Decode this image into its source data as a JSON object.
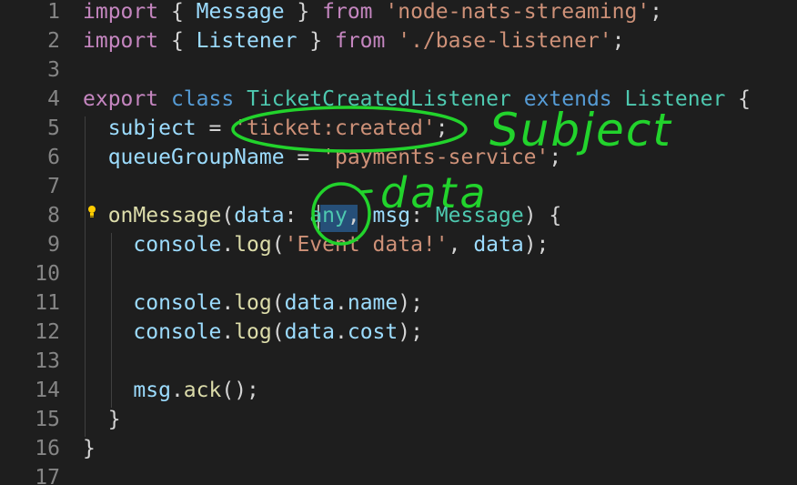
{
  "colors": {
    "background": "#1e1e1e",
    "line_number": "#858585",
    "keyword": "#c586c0",
    "storage": "#569cd6",
    "type": "#4ec9b0",
    "string": "#ce9178",
    "property": "#9cdcfe",
    "function": "#dcdcaa",
    "punctuation": "#d4d4d4",
    "annotation": "#22d32c"
  },
  "lines": [
    {
      "number": "1",
      "tokens": [
        {
          "text": "import",
          "kind": "keyword"
        },
        {
          "text": " { ",
          "kind": "punctuation"
        },
        {
          "text": "Message",
          "kind": "property"
        },
        {
          "text": " } ",
          "kind": "punctuation"
        },
        {
          "text": "from",
          "kind": "keyword"
        },
        {
          "text": " ",
          "kind": "punctuation"
        },
        {
          "text": "'node-nats-streaming'",
          "kind": "string"
        },
        {
          "text": ";",
          "kind": "punctuation"
        }
      ]
    },
    {
      "number": "2",
      "tokens": [
        {
          "text": "import",
          "kind": "keyword"
        },
        {
          "text": " { ",
          "kind": "punctuation"
        },
        {
          "text": "Listener",
          "kind": "property"
        },
        {
          "text": " } ",
          "kind": "punctuation"
        },
        {
          "text": "from",
          "kind": "keyword"
        },
        {
          "text": " ",
          "kind": "punctuation"
        },
        {
          "text": "'./base-listener'",
          "kind": "string"
        },
        {
          "text": ";",
          "kind": "punctuation"
        }
      ]
    },
    {
      "number": "3",
      "tokens": []
    },
    {
      "number": "4",
      "tokens": [
        {
          "text": "export",
          "kind": "keyword"
        },
        {
          "text": " ",
          "kind": "punctuation"
        },
        {
          "text": "class",
          "kind": "storage"
        },
        {
          "text": " ",
          "kind": "punctuation"
        },
        {
          "text": "TicketCreatedListener",
          "kind": "type"
        },
        {
          "text": " ",
          "kind": "punctuation"
        },
        {
          "text": "extends",
          "kind": "storage"
        },
        {
          "text": " ",
          "kind": "punctuation"
        },
        {
          "text": "Listener",
          "kind": "type"
        },
        {
          "text": " {",
          "kind": "punctuation"
        }
      ]
    },
    {
      "number": "5",
      "tokens": [
        {
          "text": "  ",
          "kind": "punctuation"
        },
        {
          "text": "subject",
          "kind": "property"
        },
        {
          "text": " = ",
          "kind": "punctuation"
        },
        {
          "text": "'ticket:created'",
          "kind": "string"
        },
        {
          "text": ";",
          "kind": "punctuation"
        }
      ]
    },
    {
      "number": "6",
      "tokens": [
        {
          "text": "  ",
          "kind": "punctuation"
        },
        {
          "text": "queueGroupName",
          "kind": "property"
        },
        {
          "text": " = ",
          "kind": "punctuation"
        },
        {
          "text": "'payments-service'",
          "kind": "string"
        },
        {
          "text": ";",
          "kind": "punctuation"
        }
      ]
    },
    {
      "number": "7",
      "tokens": []
    },
    {
      "number": "8",
      "tokens": [
        {
          "text": "  ",
          "kind": "punctuation"
        },
        {
          "text": "onMessage",
          "kind": "function"
        },
        {
          "text": "(",
          "kind": "punctuation"
        },
        {
          "text": "data",
          "kind": "property"
        },
        {
          "text": ": ",
          "kind": "punctuation"
        },
        {
          "text": "any",
          "kind": "type"
        },
        {
          "text": ", ",
          "kind": "punctuation"
        },
        {
          "text": "msg",
          "kind": "property"
        },
        {
          "text": ": ",
          "kind": "punctuation"
        },
        {
          "text": "Message",
          "kind": "type"
        },
        {
          "text": ") {",
          "kind": "punctuation"
        }
      ]
    },
    {
      "number": "9",
      "tokens": [
        {
          "text": "    ",
          "kind": "punctuation"
        },
        {
          "text": "console",
          "kind": "property"
        },
        {
          "text": ".",
          "kind": "punctuation"
        },
        {
          "text": "log",
          "kind": "function"
        },
        {
          "text": "(",
          "kind": "punctuation"
        },
        {
          "text": "'Event data!'",
          "kind": "string"
        },
        {
          "text": ", ",
          "kind": "punctuation"
        },
        {
          "text": "data",
          "kind": "property"
        },
        {
          "text": ");",
          "kind": "punctuation"
        }
      ]
    },
    {
      "number": "10",
      "tokens": []
    },
    {
      "number": "11",
      "tokens": [
        {
          "text": "    ",
          "kind": "punctuation"
        },
        {
          "text": "console",
          "kind": "property"
        },
        {
          "text": ".",
          "kind": "punctuation"
        },
        {
          "text": "log",
          "kind": "function"
        },
        {
          "text": "(",
          "kind": "punctuation"
        },
        {
          "text": "data",
          "kind": "property"
        },
        {
          "text": ".",
          "kind": "punctuation"
        },
        {
          "text": "name",
          "kind": "property"
        },
        {
          "text": ");",
          "kind": "punctuation"
        }
      ]
    },
    {
      "number": "12",
      "tokens": [
        {
          "text": "    ",
          "kind": "punctuation"
        },
        {
          "text": "console",
          "kind": "property"
        },
        {
          "text": ".",
          "kind": "punctuation"
        },
        {
          "text": "log",
          "kind": "function"
        },
        {
          "text": "(",
          "kind": "punctuation"
        },
        {
          "text": "data",
          "kind": "property"
        },
        {
          "text": ".",
          "kind": "punctuation"
        },
        {
          "text": "cost",
          "kind": "property"
        },
        {
          "text": ");",
          "kind": "punctuation"
        }
      ]
    },
    {
      "number": "13",
      "tokens": []
    },
    {
      "number": "14",
      "tokens": [
        {
          "text": "    ",
          "kind": "punctuation"
        },
        {
          "text": "msg",
          "kind": "property"
        },
        {
          "text": ".",
          "kind": "punctuation"
        },
        {
          "text": "ack",
          "kind": "function"
        },
        {
          "text": "();",
          "kind": "punctuation"
        }
      ]
    },
    {
      "number": "15",
      "tokens": [
        {
          "text": "  ",
          "kind": "punctuation"
        },
        {
          "text": "}",
          "kind": "punctuation"
        }
      ]
    },
    {
      "number": "16",
      "tokens": [
        {
          "text": "}",
          "kind": "punctuation"
        }
      ]
    },
    {
      "number": "17",
      "tokens": []
    }
  ],
  "annotations": {
    "subject_label": "Subject",
    "data_label": "data"
  },
  "icons": {
    "lightbulb": "lightbulb-icon"
  }
}
